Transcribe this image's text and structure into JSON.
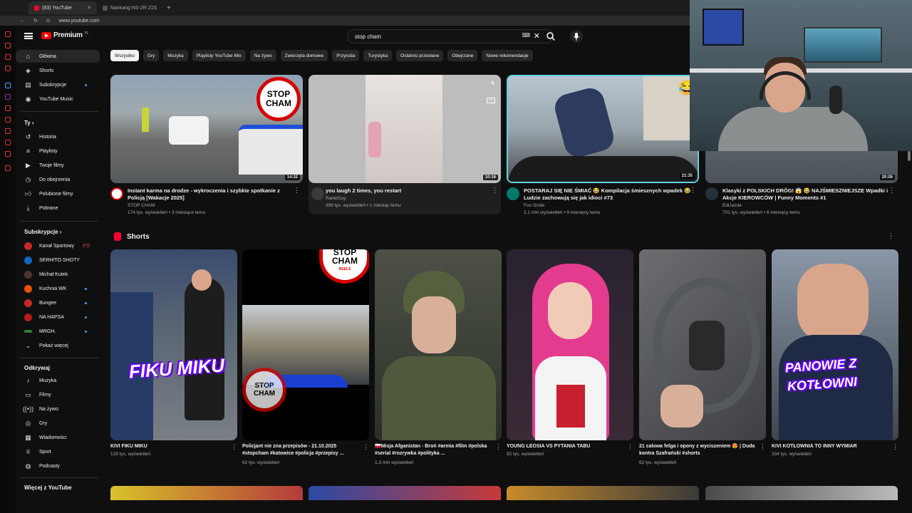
{
  "browser": {
    "tabs": [
      {
        "label": "(83) YouTube",
        "active": true
      },
      {
        "label": "Nankang NS-2R 215/3…",
        "active": false
      }
    ],
    "url": "www.youtube.com"
  },
  "youtube": {
    "logo": "Premium",
    "logo_sup": "PL",
    "search_query": "stop cham",
    "search_kbd": "⌨"
  },
  "sidebar": {
    "main": [
      {
        "label": "Główna",
        "icon": "home-icon"
      },
      {
        "label": "Shorts",
        "icon": "shorts-icon"
      },
      {
        "label": "Subskrypcje",
        "icon": "subscriptions-icon"
      },
      {
        "label": "YouTube Music",
        "icon": "music-icon"
      }
    ],
    "you_header": "Ty",
    "you": [
      {
        "label": "Historia",
        "icon": "history-icon"
      },
      {
        "label": "Playlisty",
        "icon": "playlists-icon"
      },
      {
        "label": "Twoje filmy",
        "icon": "your-videos-icon"
      },
      {
        "label": "Do obejrzenia",
        "icon": "watch-later-icon"
      },
      {
        "label": "Polubione filmy",
        "icon": "liked-icon"
      },
      {
        "label": "Pobrane",
        "icon": "download-icon"
      }
    ],
    "subs_header": "Subskrypcje",
    "subs": [
      {
        "label": "Kanał Sportowy",
        "color": "#c62828",
        "live": true
      },
      {
        "label": "SERHITO SHOTY",
        "color": "#1565c0"
      },
      {
        "label": "Michał Kutek",
        "color": "#4e342e"
      },
      {
        "label": "Kuchnia WK",
        "color": "#e65100"
      },
      {
        "label": "Bungee",
        "color": "#c62828"
      },
      {
        "label": "NA HAPSA",
        "color": "#b71c1c"
      },
      {
        "label": "MRGH.",
        "color": "#2e7d32"
      }
    ],
    "show_more": "Pokaż więcej",
    "explore_header": "Odkrywaj",
    "explore": [
      {
        "label": "Muzyka",
        "icon": "music-note-icon"
      },
      {
        "label": "Filmy",
        "icon": "film-icon"
      },
      {
        "label": "Na żywo",
        "icon": "live-icon"
      },
      {
        "label": "Gry",
        "icon": "gamepad-icon"
      },
      {
        "label": "Wiadomości",
        "icon": "news-icon"
      },
      {
        "label": "Sport",
        "icon": "trophy-icon"
      },
      {
        "label": "Podcasty",
        "icon": "podcast-icon"
      }
    ],
    "more_header": "Więcej z YouTube"
  },
  "chips": [
    "Wszystko",
    "Gry",
    "Muzyka",
    "Playlisty YouTube Mix",
    "Na żywo",
    "Zwierzęta domowe",
    "Przyroda",
    "Turystyka",
    "Ostatnio przesłane",
    "Obejrzane",
    "Nowe rekomendacje"
  ],
  "videos": [
    {
      "title": "Instant karma na drodze - wykroczenia i szybkie spotkanie z Policją [Wakacje 2025]",
      "channel": "STOP CHAM",
      "stats": "174 tys. wyświetleń • 3 miesiące temu",
      "duration": "14:32"
    },
    {
      "title": "you laugh 2 times, you restart",
      "channel": "RankiGuy",
      "stats": "399 tys. wyświetleń • 1 miesiąc temu",
      "duration": "10:16"
    },
    {
      "title": "POSTARAJ SIĘ NIE ŚMIAĆ 😂 Kompilacja śmiesznych wpadek 😂 Ludzie zachowują się jak idioci #73",
      "channel": "Fun Smile",
      "stats": "2,1 mln wyświetleń • 9 miesięcy temu",
      "duration": "21:35"
    },
    {
      "title": "Klasyki z POLSKICH DRÓG! 😱 😂 NAJŚMIESZNIEJSZE Wpadki i Akcje KIEROWCÓW | Funny Moments #1",
      "channel": "EdiJazda",
      "stats": "701 tys. wyświetleń • 6 miesięcy temu",
      "duration": "20:05"
    }
  ],
  "shorts_header": "Shorts",
  "shorts": [
    {
      "title": "KIVI FIKU MIKU",
      "views": "129 tys. wyświetleń",
      "overlay": "FIKU MIKU"
    },
    {
      "title": "Policjant nie zna przepisów - 21.10.2025 #stopcham #katowice #policja #przepisy ...",
      "views": "62 tys. wyświetleń"
    },
    {
      "title": "🇵🇱Misja Afganistan - Broń #armia #film #polska #serial #rozrywka #polityka ...",
      "views": "1,3 mln wyświetleń"
    },
    {
      "title": "YOUNG LEOSIA VS PYTANIA TABU",
      "views": "92 tys. wyświetleń"
    },
    {
      "title": "21 calowa felga i opony z wyciszeniem 😍 | Duda kontra Szafrański #shorts",
      "views": "62 tys. wyświetleń"
    },
    {
      "title": "KIVI KOTŁOWNIA TO INNY WYMIAR",
      "views": "334 tys. wyświetleń",
      "overlay": "PANOWIE Z KOTŁOWNI"
    }
  ],
  "stop_cham": {
    "line1": "STOP",
    "line2": "CHAM",
    "reels": "REELS"
  }
}
